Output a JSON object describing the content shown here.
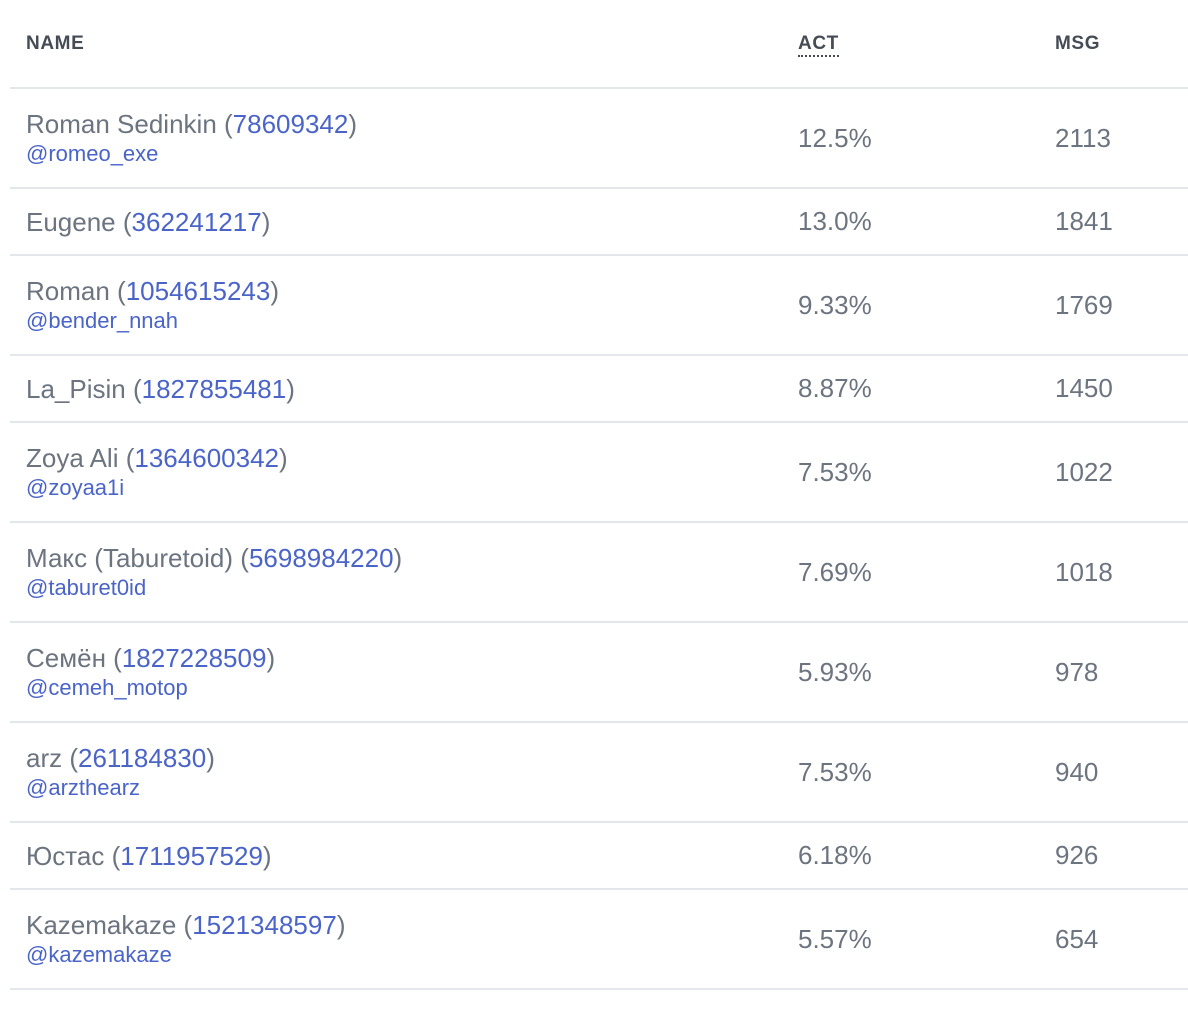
{
  "header": {
    "name": "NAME",
    "act": "ACT",
    "msg": "MSG"
  },
  "colors": {
    "link": "#4a64c8",
    "text": "#6c7480",
    "header": "#454c56",
    "divider": "#e3e6ea"
  },
  "rows": [
    {
      "name": "Roman Sedinkin",
      "id": "78609342",
      "username": "@romeo_exe",
      "act": "12.5%",
      "msg": "2113"
    },
    {
      "name": "Eugene",
      "id": "362241217",
      "username": "",
      "act": "13.0%",
      "msg": "1841"
    },
    {
      "name": "Roman",
      "id": "1054615243",
      "username": "@bender_nnah",
      "act": "9.33%",
      "msg": "1769"
    },
    {
      "name": "La_Pisin",
      "id": "1827855481",
      "username": "",
      "act": "8.87%",
      "msg": "1450"
    },
    {
      "name": "Zoya Ali",
      "id": "1364600342",
      "username": "@zoyaa1i",
      "act": "7.53%",
      "msg": "1022"
    },
    {
      "name": "Макс (Taburetoid)",
      "id": "5698984220",
      "username": "@taburet0id",
      "act": "7.69%",
      "msg": "1018"
    },
    {
      "name": "Семён",
      "id": "1827228509",
      "username": "@cemeh_motop",
      "act": "5.93%",
      "msg": "978"
    },
    {
      "name": "arz",
      "id": "261184830",
      "username": "@arzthearz",
      "act": "7.53%",
      "msg": "940"
    },
    {
      "name": "Юстас",
      "id": "1711957529",
      "username": "",
      "act": "6.18%",
      "msg": "926"
    },
    {
      "name": "Kazemakaze",
      "id": "1521348597",
      "username": "@kazemakaze",
      "act": "5.57%",
      "msg": "654"
    }
  ]
}
